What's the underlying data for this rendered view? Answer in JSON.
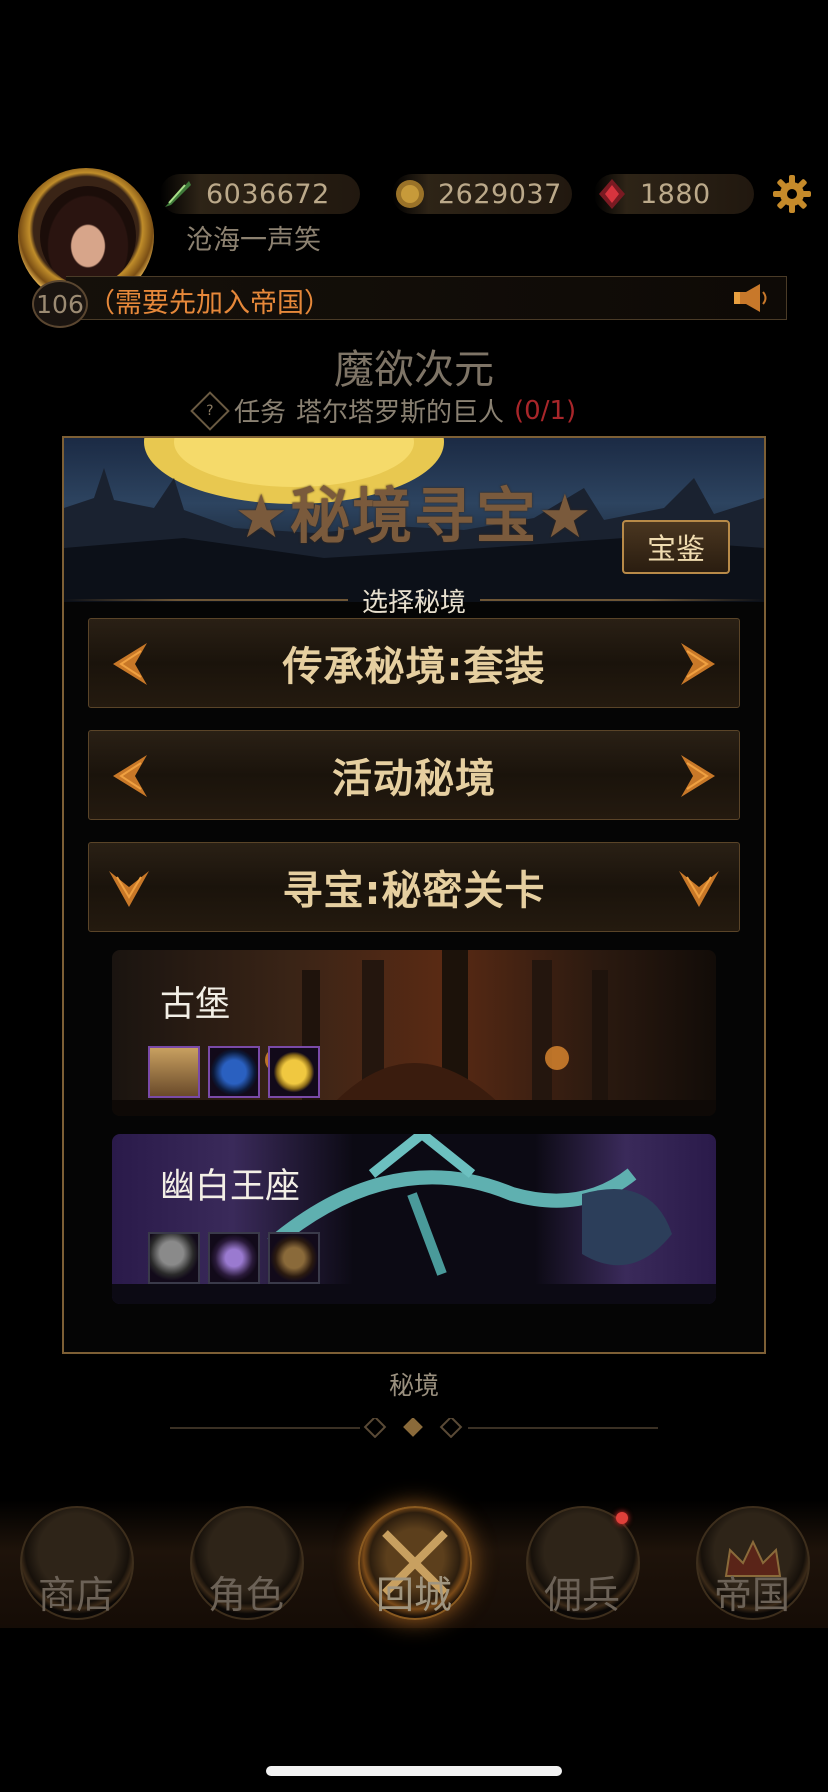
{
  "player": {
    "name": "沧海一声笑",
    "level": "106",
    "guild_notice": "（需要先加入帝国）"
  },
  "resources": [
    {
      "icon": "feather-quill-icon",
      "value": "6036672"
    },
    {
      "icon": "gold-coin-icon",
      "value": "2629037"
    },
    {
      "icon": "red-gem-icon",
      "value": "1880"
    }
  ],
  "zone": {
    "title": "魔欲次元",
    "quest_label": "任务",
    "quest_name": "塔尔塔罗斯的巨人",
    "quest_progress": "(0/1)"
  },
  "panel": {
    "banner_title": "★秘境寻宝★",
    "treasure_button": "宝鉴",
    "select_label": "选择秘境",
    "options": [
      {
        "label": "传承秘境:套装",
        "arrows": "left-right"
      },
      {
        "label": "活动秘境",
        "arrows": "left-right"
      },
      {
        "label": "寻宝:秘密关卡",
        "arrows": "expand"
      }
    ],
    "cards": [
      {
        "name": "古堡",
        "slots": [
          "blonde-hero-portrait-icon",
          "blue-rune-orb-icon",
          "gold-coin-icon"
        ]
      },
      {
        "name": "幽白王座",
        "slots": [
          "hooded-hero-portrait-icon",
          "purple-crystal-icon",
          "scroll-map-icon"
        ]
      }
    ],
    "footer_label": "秘境"
  },
  "nav": [
    {
      "label": "商店",
      "icon": "castle-shop-icon"
    },
    {
      "label": "角色",
      "icon": "hooded-character-icon"
    },
    {
      "label": "回城",
      "icon": "crossed-swords-icon",
      "active": true
    },
    {
      "label": "佣兵",
      "icon": "mercenary-icon"
    },
    {
      "label": "帝国",
      "icon": "crown-icon"
    }
  ],
  "colors": {
    "accent_gold": "#e6cfa0",
    "guild_orange": "#e6883a",
    "progress_red": "#a8262a",
    "border_bronze": "#7d5f35"
  }
}
